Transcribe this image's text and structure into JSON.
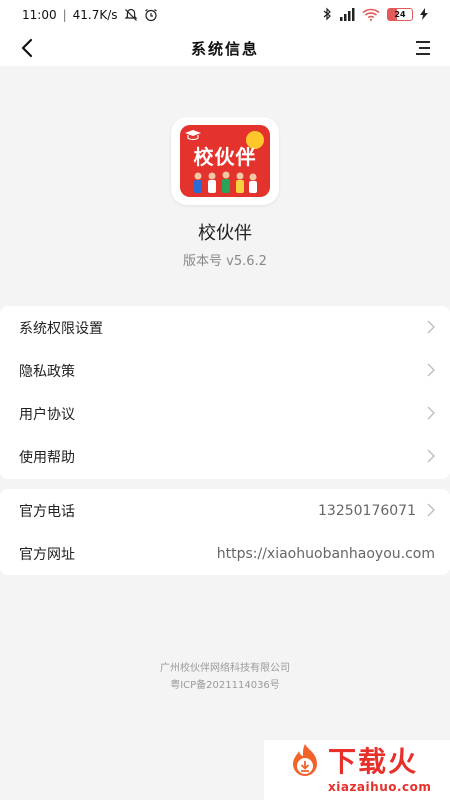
{
  "status_bar": {
    "time": "11:00",
    "network_speed": "41.7K/s",
    "battery_level": "24"
  },
  "header": {
    "title": "系统信息"
  },
  "app": {
    "icon_brand_text": "校伙伴",
    "name": "校伙伴",
    "version": "版本号 v5.6.2"
  },
  "menu_group_1": {
    "items": [
      {
        "label": "系统权限设置"
      },
      {
        "label": "隐私政策"
      },
      {
        "label": "用户协议"
      },
      {
        "label": "使用帮助"
      }
    ]
  },
  "menu_group_2": {
    "items": [
      {
        "label": "官方电话",
        "value": "13250176071"
      },
      {
        "label": "官方网址",
        "value": "https://xiaohuobanhaoyou.com"
      }
    ]
  },
  "footer": {
    "company": "广州校伙伴网络科技有限公司",
    "icp": "粤ICP备2021114036号"
  },
  "watermark": {
    "text": "下载火",
    "domain": "xiazaihuo.com"
  },
  "colors": {
    "brand_red": "#e4322c",
    "background": "#f4f4f4",
    "watermark_red": "#e8302b"
  }
}
